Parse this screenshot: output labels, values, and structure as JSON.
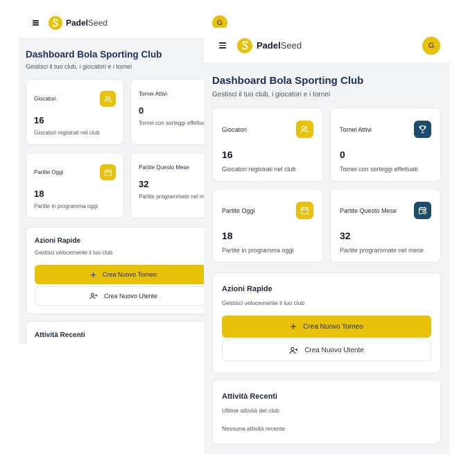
{
  "app": {
    "brand_bold": "Padel",
    "brand_light": "Seed",
    "avatar_initial": "G"
  },
  "dashboard": {
    "title": "Dashboard Bola Sporting Club",
    "subtitle": "Gestisci il tuo club, i giocatori e i tornei"
  },
  "stats": [
    {
      "label": "Giocatori",
      "value": "16",
      "desc": "Giocatori registrati nel club",
      "icon": "users-icon",
      "color": "#e8c10b"
    },
    {
      "label": "Tornei Attivi",
      "value": "0",
      "desc": "Tornei con sorteggi effettuati",
      "icon": "trophy-icon",
      "color": "#1e4d6b"
    },
    {
      "label": "Partite Oggi",
      "value": "18",
      "desc": "Partite in programma oggi",
      "icon": "calendar-icon",
      "color": "#e8c10b"
    },
    {
      "label": "Partite Questo Mese",
      "value": "32",
      "desc": "Partite programmate nel mese",
      "icon": "calendar-clock-icon",
      "color": "#1e4d6b"
    }
  ],
  "quick_actions": {
    "title": "Azioni Rapide",
    "subtitle": "Gestisci velocemente il tuo club",
    "new_tournament": "Crea Nuovo Torneo",
    "new_user": "Crea Nuovo Utente"
  },
  "recent": {
    "title": "Attività Recenti",
    "subtitle": "Ultime attività del club",
    "empty": "Nessuna attività recente"
  },
  "colors": {
    "accent": "#e8c10b",
    "navy": "#1e4d6b",
    "title": "#1f2d5a"
  }
}
